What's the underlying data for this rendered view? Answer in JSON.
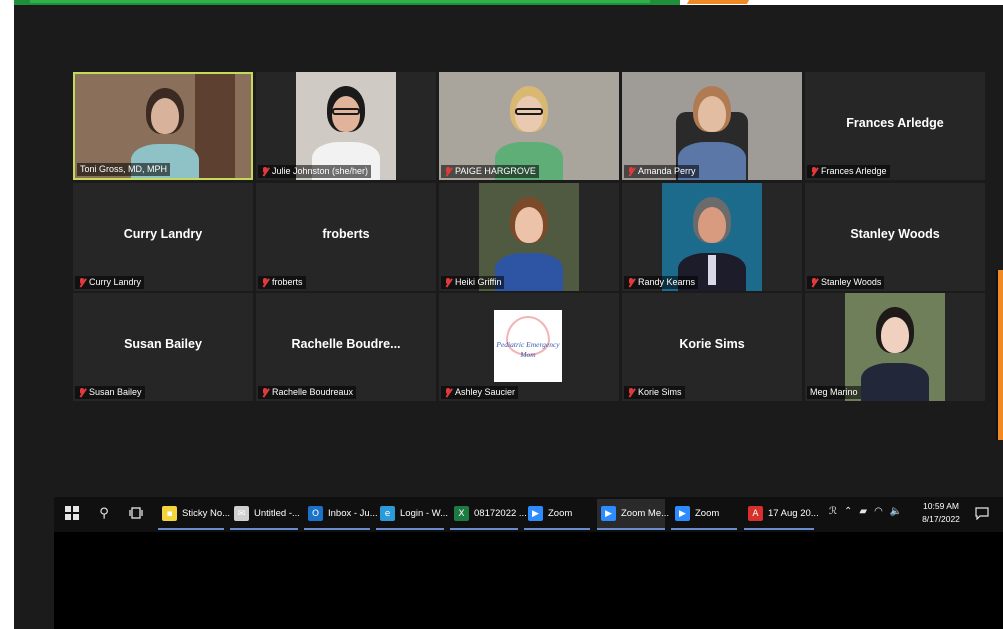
{
  "gallery": {
    "tiles": [
      {
        "display_name": "",
        "label": "Toni Gross, MD, MPH",
        "muted": false
      },
      {
        "display_name": "",
        "label": "Julie Johnston (she/her)",
        "muted": true
      },
      {
        "display_name": "",
        "label": "PAIGE HARGROVE",
        "muted": true
      },
      {
        "display_name": "",
        "label": "Amanda Perry",
        "muted": true
      },
      {
        "display_name": "Frances Arledge",
        "label": "Frances Arledge",
        "muted": true
      },
      {
        "display_name": "Curry Landry",
        "label": "Curry Landry",
        "muted": true
      },
      {
        "display_name": "froberts",
        "label": "froberts",
        "muted": true
      },
      {
        "display_name": "",
        "label": "Heiki Griffin",
        "muted": true
      },
      {
        "display_name": "",
        "label": "Randy Kearns",
        "muted": true
      },
      {
        "display_name": "Stanley Woods",
        "label": "Stanley Woods",
        "muted": true
      },
      {
        "display_name": "Susan Bailey",
        "label": "Susan Bailey",
        "muted": true
      },
      {
        "display_name": "Rachelle Boudre...",
        "label": "Rachelle Boudreaux",
        "muted": true
      },
      {
        "display_name": "",
        "label": "Ashley Saucier",
        "muted": true,
        "logo_text": "Pediatric Emergency Mom"
      },
      {
        "display_name": "Korie Sims",
        "label": "Korie Sims",
        "muted": true
      },
      {
        "display_name": "",
        "label": "Meg Marino",
        "muted": false
      }
    ],
    "active_speaker_color": "#c5d95a",
    "muted_icon_color": "#e03a3a"
  },
  "taskbar": {
    "apps": [
      {
        "label": "Sticky No...",
        "icon": "sticky-notes-icon",
        "color": "#f5d33a"
      },
      {
        "label": "Untitled -...",
        "icon": "mail-icon",
        "color": "#cfcfcf"
      },
      {
        "label": "Inbox - Ju...",
        "icon": "outlook-icon",
        "color": "#1a73c8"
      },
      {
        "label": "Login - W...",
        "icon": "edge-icon",
        "color": "#2a9ad8"
      },
      {
        "label": "08172022 ...",
        "icon": "excel-icon",
        "color": "#1e7a45"
      },
      {
        "label": "Zoom",
        "icon": "zoom-icon",
        "color": "#2d8cff"
      },
      {
        "label": "Zoom Me...",
        "icon": "zoom-icon",
        "color": "#2d8cff"
      },
      {
        "label": "Zoom",
        "icon": "zoom-icon",
        "color": "#2d8cff"
      },
      {
        "label": "17 Aug 20...",
        "icon": "pdf-icon",
        "color": "#d8302a"
      }
    ],
    "clock": {
      "time": "10:59 AM",
      "date": "8/17/2022"
    }
  }
}
